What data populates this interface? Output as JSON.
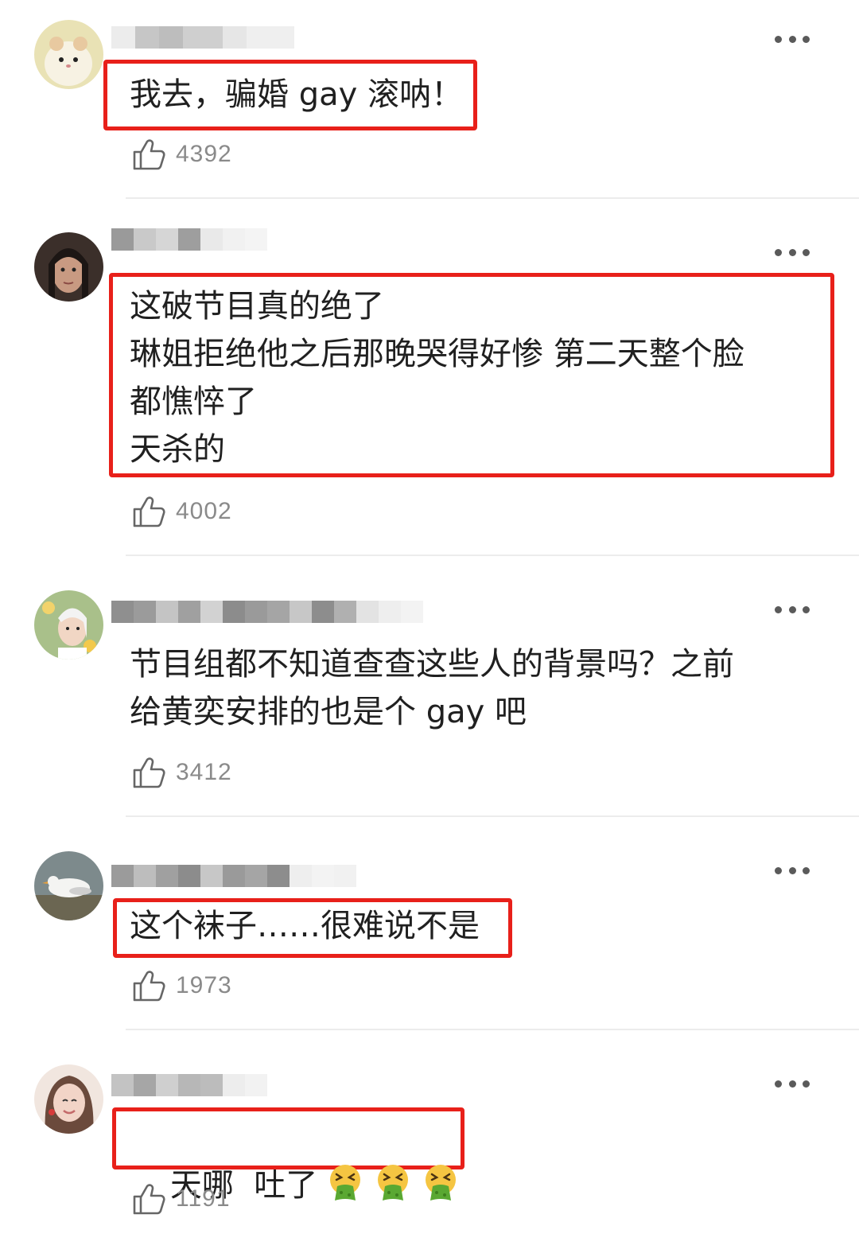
{
  "comments": [
    {
      "username_blurred": "",
      "text": "我去，骗婚 gay 滚呐！",
      "likes": "4392",
      "highlighted": true,
      "avatar": "hamster-avatar"
    },
    {
      "username_blurred": "",
      "text": "这破节目真的绝了\n琳姐拒绝他之后那晚哭得好惨 第二天整个脸\n都憔悴了\n天杀的",
      "likes": "4002",
      "highlighted": true,
      "avatar": "woman-avatar"
    },
    {
      "username_blurred": "",
      "text": "节目组都不知道查查这些人的背景吗？之前\n给黄奕安排的也是个 gay 吧",
      "likes": "3412",
      "highlighted": false,
      "avatar": "girl-flowers-avatar"
    },
    {
      "username_blurred": "",
      "text": "这个袜子……很难说不是",
      "likes": "1973",
      "highlighted": true,
      "avatar": "seagull-avatar"
    },
    {
      "username_blurred": "",
      "text": "天哪  吐了",
      "likes": "1191",
      "highlighted": true,
      "avatar": "smiling-woman-avatar",
      "emojis": [
        "vomiting-face-emoji",
        "vomiting-face-emoji",
        "vomiting-face-emoji"
      ]
    }
  ],
  "colors": {
    "highlight_border": "#e8201a",
    "like_count": "#8a8a8a",
    "divider": "#ececec"
  }
}
